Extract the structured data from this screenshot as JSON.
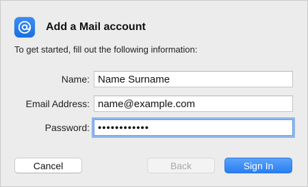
{
  "dialog": {
    "title": "Add a Mail account",
    "icon": "at-sign-icon",
    "intro": "To get started, fill out the following information:"
  },
  "form": {
    "name_label": "Name:",
    "name_value": "Name Surname",
    "email_label": "Email Address:",
    "email_value": "name@example.com",
    "password_label": "Password:",
    "password_value": "••••••••••••"
  },
  "buttons": {
    "cancel": "Cancel",
    "back": "Back",
    "sign_in": "Sign In"
  },
  "colors": {
    "accent": "#2b7ef2",
    "icon_blue": "#1a6fe0",
    "focus_ring": "#8cb6f0"
  }
}
